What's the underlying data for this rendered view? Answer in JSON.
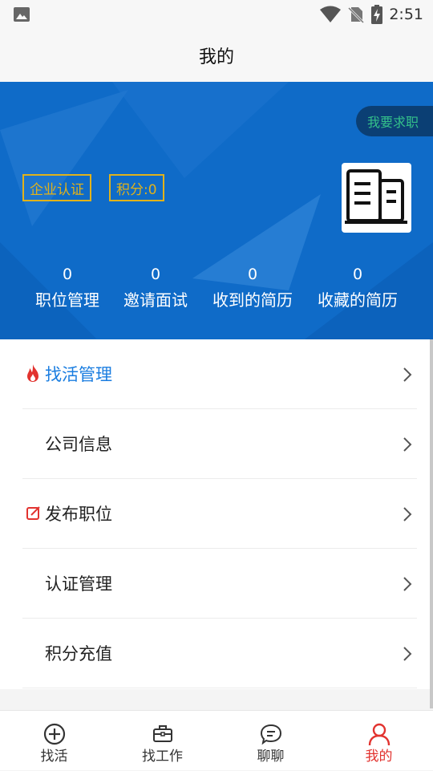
{
  "status_bar": {
    "time": "2:51"
  },
  "header": {
    "title": "我的"
  },
  "hero": {
    "job_seek_button": "我要求职",
    "cert_badge": "企业认证",
    "points_badge": "积分:0",
    "stats": [
      {
        "value": "0",
        "label": "职位管理"
      },
      {
        "value": "0",
        "label": "邀请面试"
      },
      {
        "value": "0",
        "label": "收到的简历"
      },
      {
        "value": "0",
        "label": "收藏的简历"
      }
    ]
  },
  "menu": {
    "items": [
      {
        "label": "找活管理",
        "icon": "fire-icon",
        "highlight": true
      },
      {
        "label": "公司信息",
        "icon": ""
      },
      {
        "label": "发布职位",
        "icon": "edit-icon"
      },
      {
        "label": "认证管理",
        "icon": ""
      },
      {
        "label": "积分充值",
        "icon": ""
      }
    ]
  },
  "tabbar": {
    "tabs": [
      {
        "label": "找活",
        "icon": "plus-circle-icon"
      },
      {
        "label": "找工作",
        "icon": "briefcase-icon"
      },
      {
        "label": "聊聊",
        "icon": "chat-bubble-icon"
      },
      {
        "label": "我的",
        "icon": "person-icon",
        "active": true
      }
    ]
  },
  "colors": {
    "hero_blue": "#0f6bc8",
    "active_red": "#e2332f",
    "gold": "#e1b21a",
    "link_blue": "#1a7de0"
  }
}
